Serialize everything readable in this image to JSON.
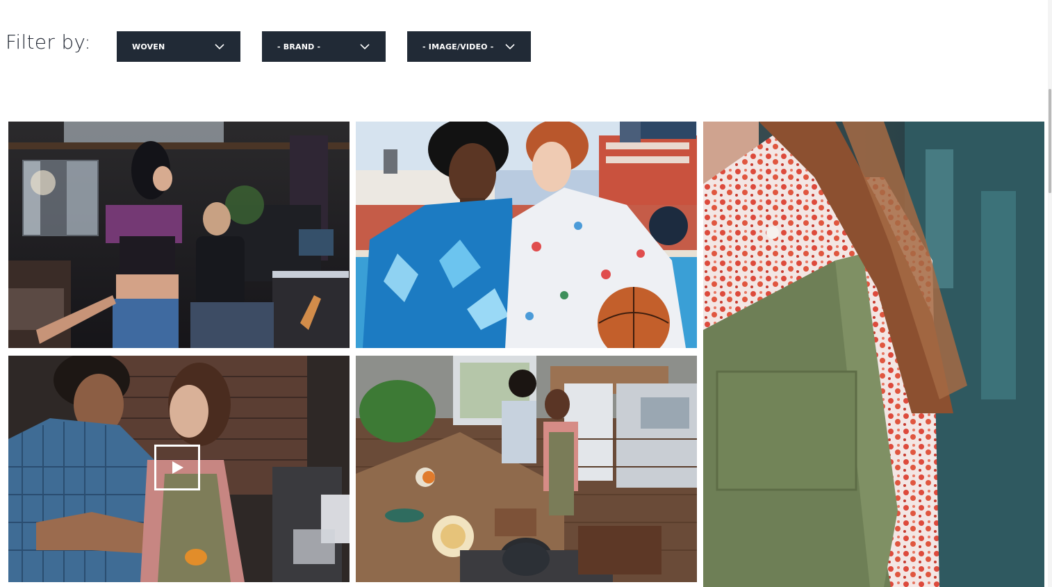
{
  "filters": {
    "label": "Filter by:",
    "dropdowns": [
      {
        "selected": "WOVEN",
        "icon": "chevron-down-icon"
      },
      {
        "selected": "- BRAND -",
        "icon": "chevron-down-icon"
      },
      {
        "selected": "- IMAGE/VIDEO -",
        "icon": "chevron-down-icon"
      }
    ]
  },
  "gallery": {
    "items": [
      {
        "type": "image",
        "subject": "music studio scene"
      },
      {
        "type": "image",
        "subject": "two men in floral shirts with basketball"
      },
      {
        "type": "image",
        "subject": "red floral shirt with green apron close-up"
      },
      {
        "type": "video",
        "subject": "couple cooking",
        "overlay_icon": "play-icon"
      },
      {
        "type": "image",
        "subject": "overhead kitchen cooking scene"
      }
    ]
  },
  "colors": {
    "dropdown_bg": "#212a36",
    "dropdown_text": "#ffffff",
    "label_text": "#222834"
  }
}
